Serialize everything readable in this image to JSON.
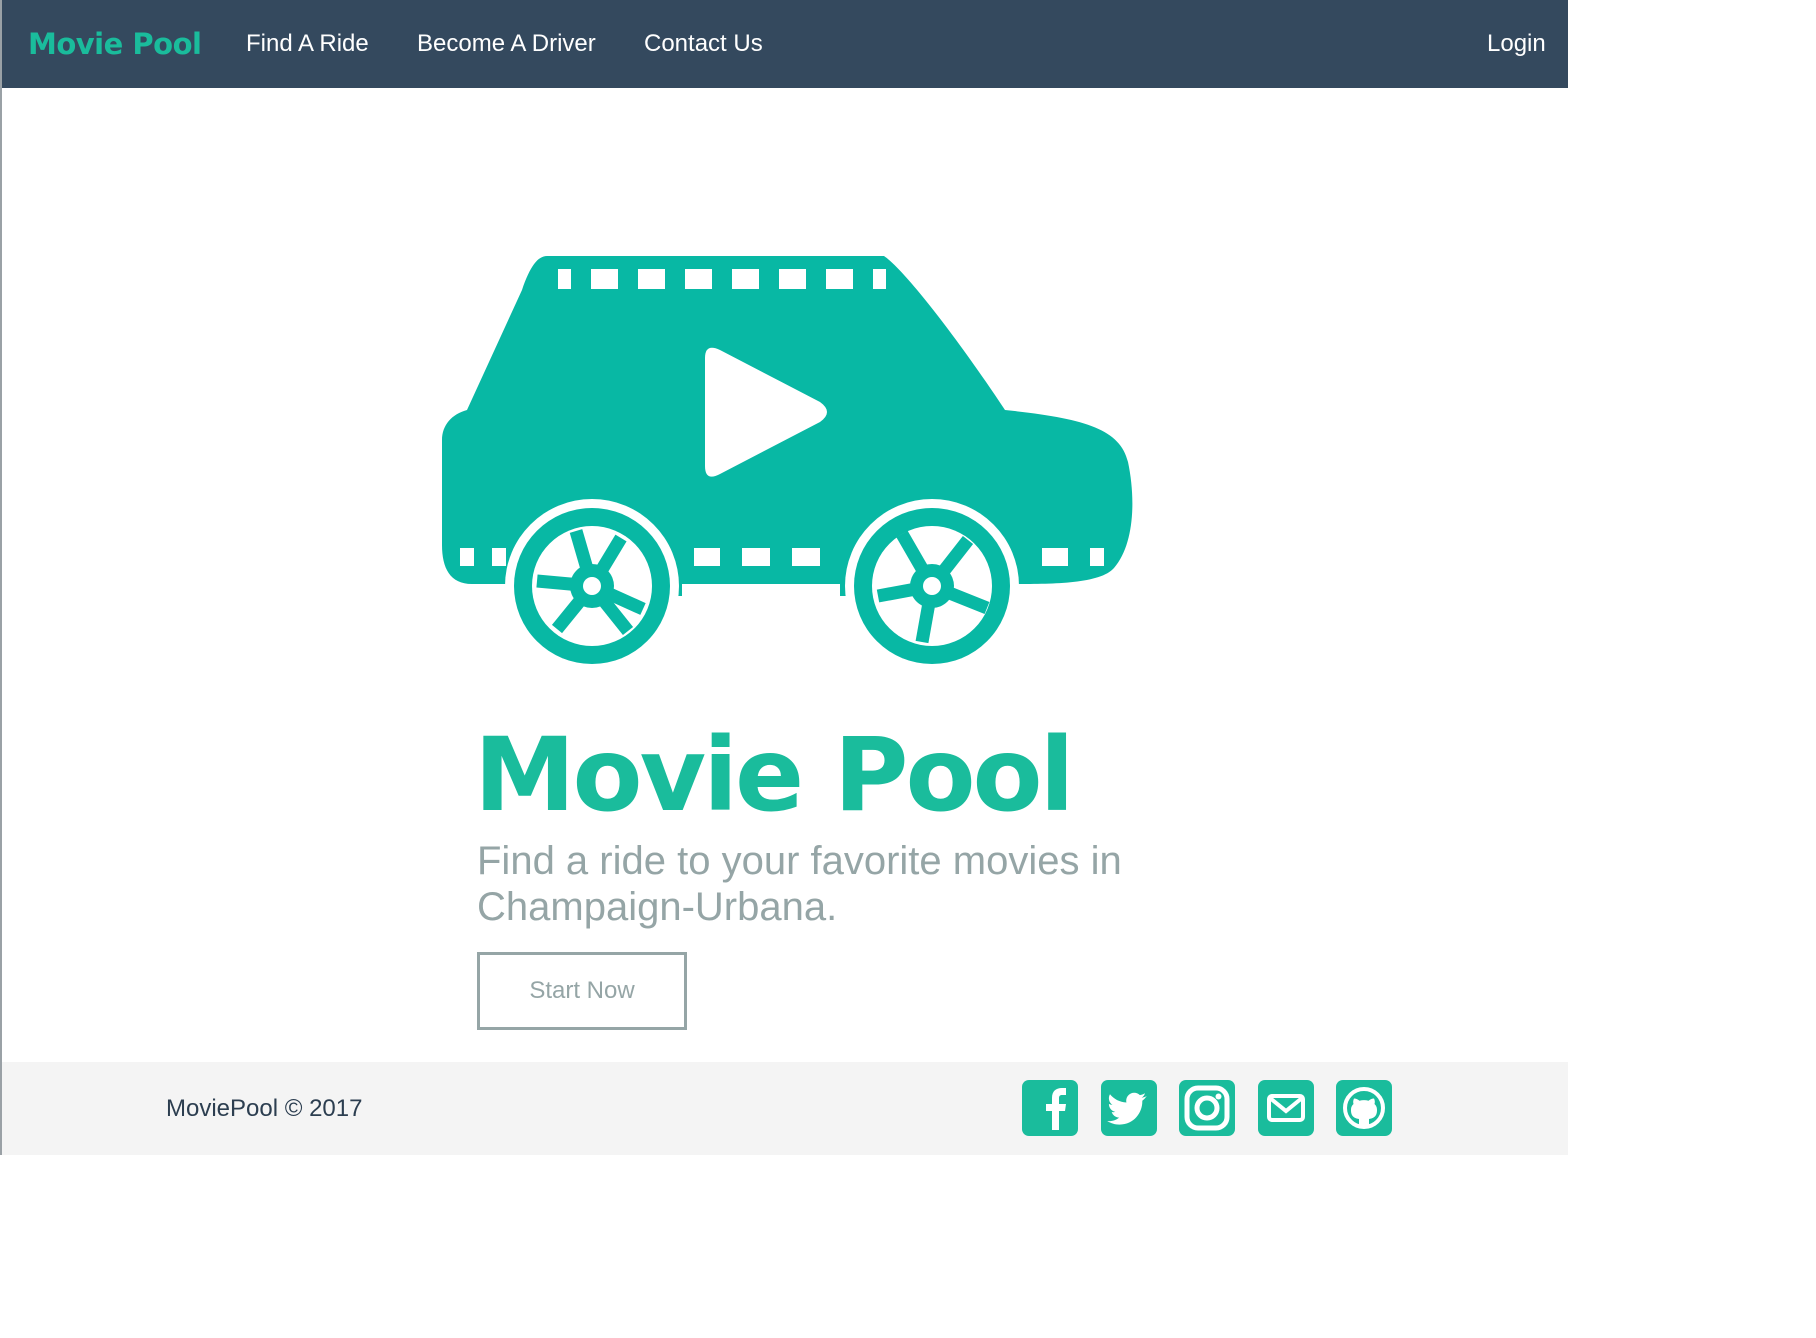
{
  "colors": {
    "navbar": "#34495e",
    "accent": "#1abc9c",
    "logo_fill": "#08b8a4",
    "muted_text": "#95a5a6",
    "footer_bg": "#f4f4f4",
    "white": "#ffffff"
  },
  "navbar": {
    "brand": "Movie Pool",
    "links": [
      {
        "label": "Find A Ride"
      },
      {
        "label": "Become A Driver"
      },
      {
        "label": "Contact Us"
      }
    ],
    "login": "Login"
  },
  "hero": {
    "logo_icon": "film-car-icon",
    "title": "Movie Pool",
    "tagline": "Find a ride to your favorite movies in Champaign-Urbana.",
    "cta": "Start Now"
  },
  "footer": {
    "copyright": "MoviePool © 2017",
    "social": [
      {
        "icon": "facebook-icon"
      },
      {
        "icon": "twitter-icon"
      },
      {
        "icon": "instagram-icon"
      },
      {
        "icon": "mail-icon"
      },
      {
        "icon": "github-icon"
      }
    ]
  }
}
